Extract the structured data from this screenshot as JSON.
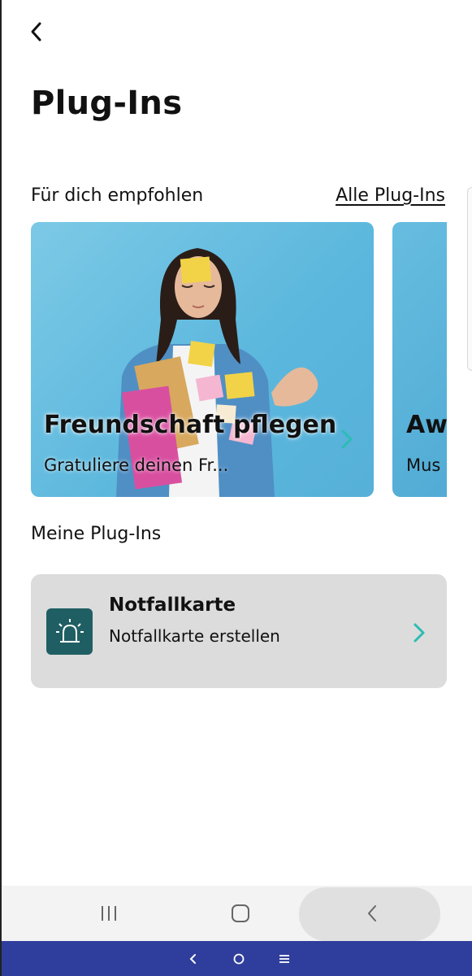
{
  "header": {
    "title": "Plug-Ins"
  },
  "recommended": {
    "label": "Für dich empfohlen",
    "all_link": "Alle Plug-Ins",
    "cards": [
      {
        "title": "Freundschaft pflegen",
        "subtitle": "Gratuliere deinen Fr..."
      },
      {
        "title": "Aw",
        "subtitle": "Mus"
      }
    ]
  },
  "my_plugins": {
    "label": "Meine Plug-Ins",
    "items": [
      {
        "name": "Notfallkarte",
        "description": "Notfallkarte erstellen",
        "icon": "alarm-siren-icon"
      }
    ]
  },
  "colors": {
    "accent": "#2bbdb4",
    "plugin_icon_bg": "#1f5f63",
    "card_bg": "#dcdcdc",
    "bottom_strip": "#2f3e9c"
  }
}
